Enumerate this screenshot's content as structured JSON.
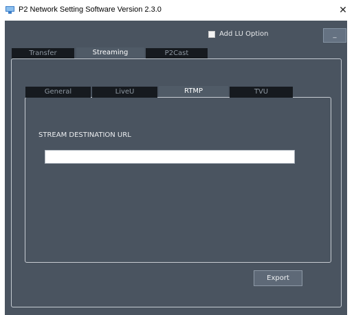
{
  "window": {
    "title": "P2 Network Setting Software  Version 2.3.0",
    "close_label": "✕",
    "icon": "app-icon"
  },
  "options": {
    "add_lu_label": "Add LU Option",
    "add_lu_checked": false,
    "minimize_label": "_"
  },
  "tabs": [
    {
      "label": "Transfer",
      "active": false
    },
    {
      "label": "Streaming",
      "active": true
    },
    {
      "label": "P2Cast",
      "active": false
    }
  ],
  "subtabs": [
    {
      "label": "General",
      "active": false
    },
    {
      "label": "LiveU",
      "active": false
    },
    {
      "label": "RTMP",
      "active": true
    },
    {
      "label": "TVU",
      "active": false
    }
  ],
  "rtmp": {
    "url_label": "STREAM DESTINATION URL",
    "url_value": "",
    "export_label": "Export"
  },
  "colors": {
    "background": "#4a5460",
    "tab_inactive": "#161a1f",
    "tab_active": "#505b67",
    "panel_border": "#c5ccd3"
  }
}
